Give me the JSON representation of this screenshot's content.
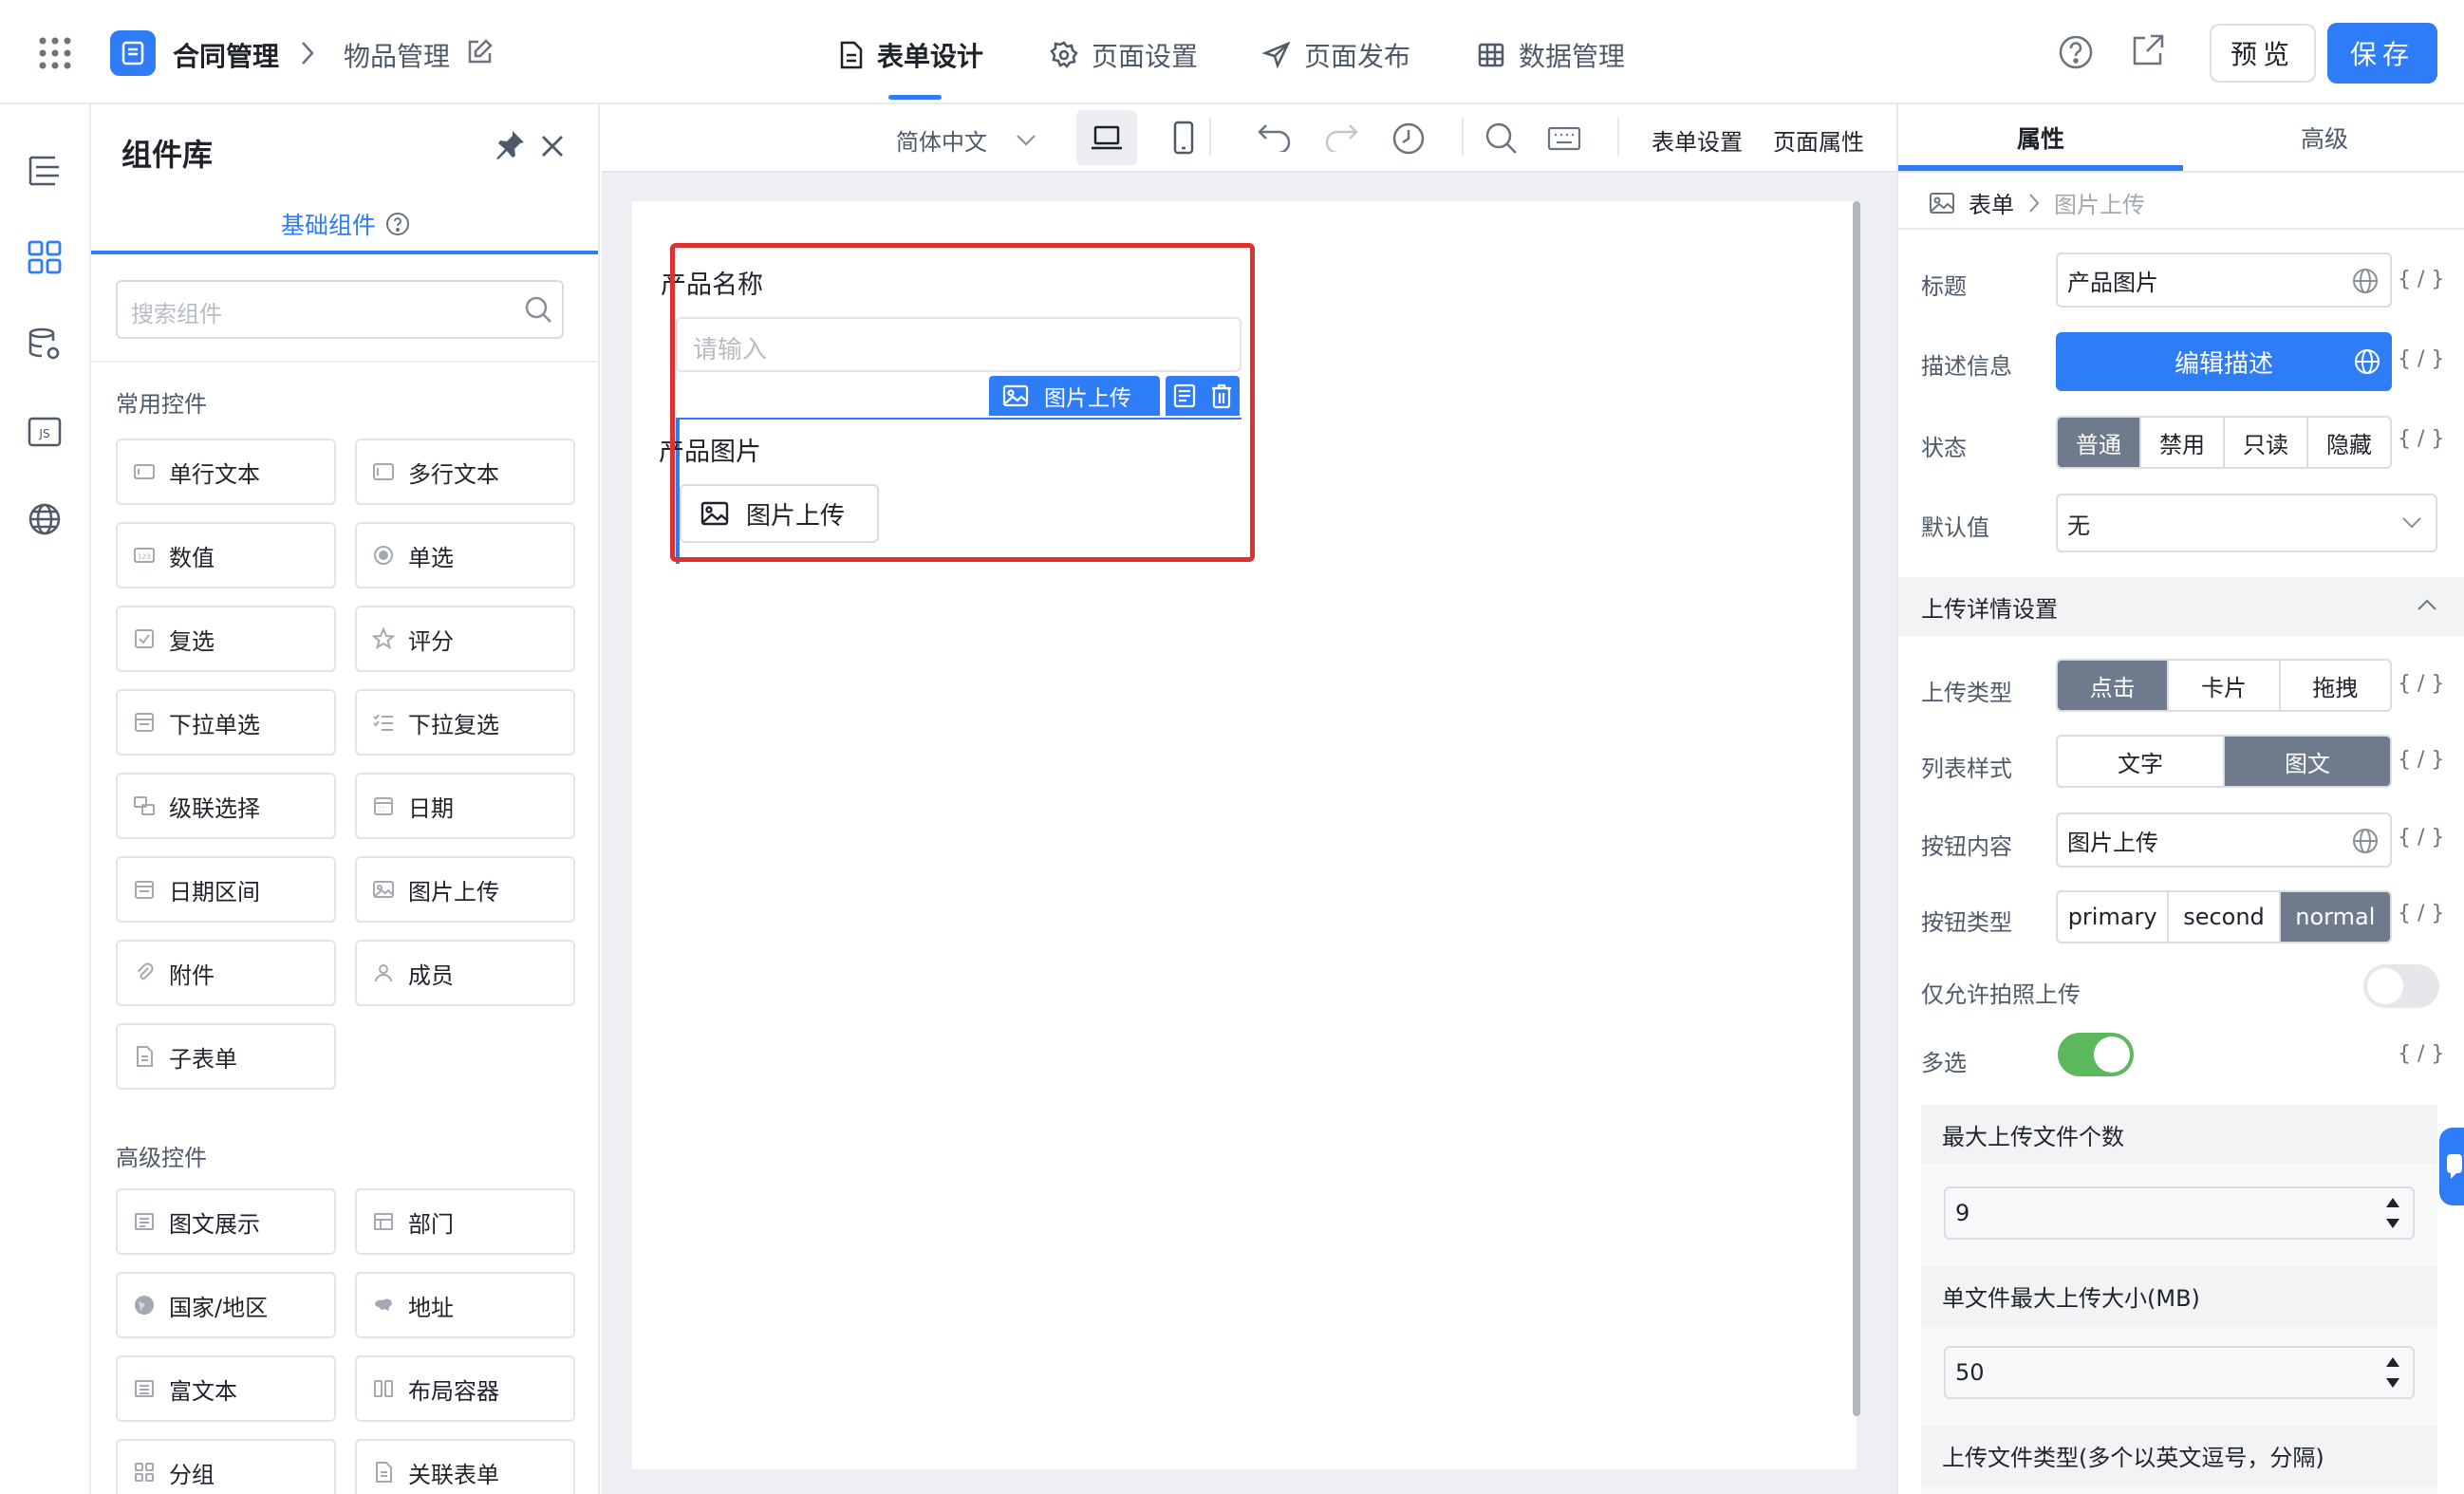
{
  "header": {
    "app_name": "合同管理",
    "sub_name": "物品管理",
    "tabs": [
      {
        "label": "表单设计",
        "icon": "document-icon",
        "active": true
      },
      {
        "label": "页面设置",
        "icon": "gear-icon",
        "active": false
      },
      {
        "label": "页面发布",
        "icon": "send-icon",
        "active": false
      },
      {
        "label": "数据管理",
        "icon": "table-icon",
        "active": false
      }
    ],
    "preview_label": "预览",
    "save_label": "保存"
  },
  "component_panel": {
    "title": "组件库",
    "tab_label": "基础组件",
    "search_placeholder": "搜索组件",
    "common_section": "常用控件",
    "common_items": [
      {
        "label": "单行文本",
        "icon": "single-line-text-icon"
      },
      {
        "label": "多行文本",
        "icon": "multi-line-text-icon"
      },
      {
        "label": "数值",
        "icon": "number-icon"
      },
      {
        "label": "单选",
        "icon": "radio-icon"
      },
      {
        "label": "复选",
        "icon": "checkbox-icon"
      },
      {
        "label": "评分",
        "icon": "star-icon"
      },
      {
        "label": "下拉单选",
        "icon": "dropdown-single-icon"
      },
      {
        "label": "下拉复选",
        "icon": "dropdown-multi-icon"
      },
      {
        "label": "级联选择",
        "icon": "cascade-icon"
      },
      {
        "label": "日期",
        "icon": "calendar-icon"
      },
      {
        "label": "日期区间",
        "icon": "date-range-icon"
      },
      {
        "label": "图片上传",
        "icon": "image-upload-icon"
      },
      {
        "label": "附件",
        "icon": "attachment-icon"
      },
      {
        "label": "成员",
        "icon": "member-icon"
      },
      {
        "label": "子表单",
        "icon": "subform-icon"
      }
    ],
    "advanced_section": "高级控件",
    "advanced_items": [
      {
        "label": "图文展示",
        "icon": "image-text-icon"
      },
      {
        "label": "部门",
        "icon": "department-icon"
      },
      {
        "label": "国家/地区",
        "icon": "globe-icon"
      },
      {
        "label": "地址",
        "icon": "map-icon"
      },
      {
        "label": "富文本",
        "icon": "rich-text-icon"
      },
      {
        "label": "布局容器",
        "icon": "layout-icon"
      },
      {
        "label": "分组",
        "icon": "group-icon"
      },
      {
        "label": "关联表单",
        "icon": "linked-form-icon"
      }
    ]
  },
  "toolbar": {
    "language": "简体中文",
    "form_settings": "表单设置",
    "page_properties": "页面属性"
  },
  "form": {
    "field1_label": "产品名称",
    "field1_placeholder": "请输入",
    "selected_tag": "图片上传",
    "field2_label": "产品图片",
    "upload_button": "图片上传"
  },
  "properties": {
    "tab_props": "属性",
    "tab_advanced": "高级",
    "breadcrumb_root": "表单",
    "breadcrumb_current": "图片上传",
    "title_label": "标题",
    "title_value": "产品图片",
    "desc_label": "描述信息",
    "desc_button": "编辑描述",
    "status_label": "状态",
    "status_options": [
      "普通",
      "禁用",
      "只读",
      "隐藏"
    ],
    "default_label": "默认值",
    "default_value": "无",
    "upload_section": "上传详情设置",
    "upload_type_label": "上传类型",
    "upload_type_options": [
      "点击",
      "卡片",
      "拖拽"
    ],
    "list_style_label": "列表样式",
    "list_style_options": [
      "文字",
      "图文"
    ],
    "button_content_label": "按钮内容",
    "button_content_value": "图片上传",
    "button_type_label": "按钮类型",
    "button_type_options": [
      "primary",
      "second",
      "normal"
    ],
    "camera_only_label": "仅允许拍照上传",
    "multi_label": "多选",
    "max_files_label": "最大上传文件个数",
    "max_files_value": "9",
    "max_size_label": "单文件最大上传大小(MB)",
    "max_size_value": "50",
    "file_types_label": "上传文件类型(多个以英文逗号，分隔)",
    "variable_marker": "{ / }"
  },
  "colors": {
    "primary": "#2f7df6",
    "segment_selected": "#6e7b8d",
    "selection_outline": "#e03131",
    "toggle_on": "#5cb85c"
  }
}
